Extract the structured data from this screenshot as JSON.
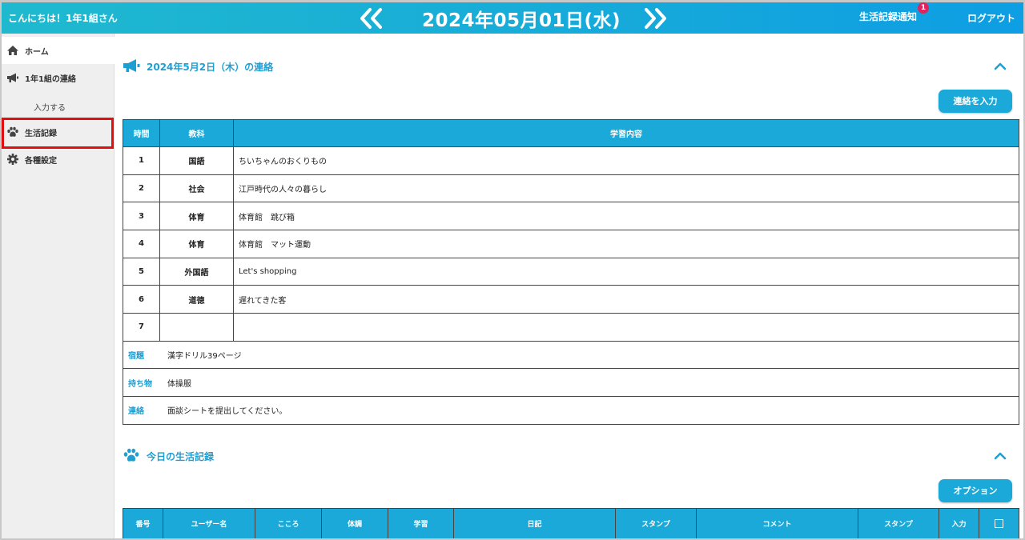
{
  "header": {
    "greeting": "こんにちは！1年1組さん",
    "date": "2024年05月01日(水)",
    "notify_label": "生活記録通知",
    "notify_count": "1",
    "logout_label": "ログアウト"
  },
  "sidebar": {
    "items": [
      {
        "label": "ホーム",
        "icon": "home-icon"
      },
      {
        "label": "1年1組の連絡",
        "icon": "megaphone-icon"
      },
      {
        "label": "入力する"
      },
      {
        "label": "生活記録",
        "icon": "paw-icon"
      },
      {
        "label": "各種設定",
        "icon": "gear-icon"
      }
    ]
  },
  "notice": {
    "title": "2024年5月2日（木）の連絡",
    "input_button": "連絡を入力",
    "headers": [
      "時間",
      "教科",
      "学習内容"
    ],
    "rows": [
      {
        "period": "1",
        "subject": "国語",
        "content": "ちいちゃんのおくりもの"
      },
      {
        "period": "2",
        "subject": "社会",
        "content": "江戸時代の人々の暮らし"
      },
      {
        "period": "3",
        "subject": "体育",
        "content": "体育館　跳び箱"
      },
      {
        "period": "4",
        "subject": "体育",
        "content": "体育館　マット運動"
      },
      {
        "period": "5",
        "subject": "外国語",
        "content": "Let's shopping"
      },
      {
        "period": "6",
        "subject": "道徳",
        "content": "遅れてきた客"
      },
      {
        "period": "7",
        "subject": "",
        "content": ""
      }
    ],
    "homework_label": "宿題",
    "homework": "漢字ドリル39ページ",
    "items_label": "持ち物",
    "items": "体操服",
    "contact_label": "連絡",
    "contact": "面談シートを提出してください。"
  },
  "life": {
    "title": "今日の生活記録",
    "option_button": "オプション",
    "headers": [
      "番号",
      "ユーザー名",
      "こころ",
      "体調",
      "学習",
      "日記",
      "スタンプ",
      "コメント",
      "スタンプ",
      "入力"
    ]
  },
  "colors": {
    "accent": "#1aa9d8",
    "highlight": "#e01010",
    "badge": "#e0245e"
  }
}
